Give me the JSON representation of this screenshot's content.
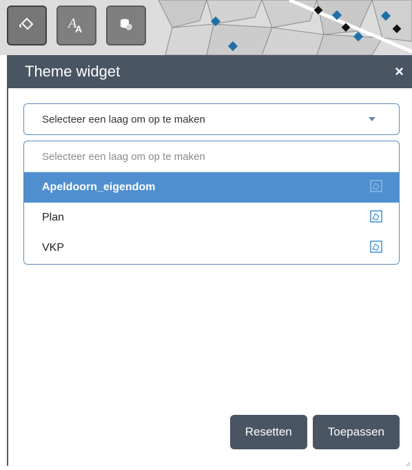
{
  "toolbar": {
    "buttons": [
      {
        "icon": "paint-bucket-icon"
      },
      {
        "icon": "font-style-icon"
      },
      {
        "icon": "database-layers-icon"
      }
    ]
  },
  "widget": {
    "title": "Theme widget",
    "close_label": "×",
    "select": {
      "value": "Selecteer een laag om op te maken"
    },
    "dropdown": {
      "placeholder": "Selecteer een laag om op te maken",
      "items": [
        {
          "label": "Apeldoorn_eigendom",
          "selected": true,
          "icon": "polygon-layer-icon"
        },
        {
          "label": "Plan",
          "selected": false,
          "icon": "polygon-layer-icon"
        },
        {
          "label": "VKP",
          "selected": false,
          "icon": "polygon-layer-icon"
        }
      ]
    },
    "reset_label": "Resetten",
    "apply_label": "Toepassen"
  },
  "colors": {
    "header": "#4a5563",
    "accent": "#4f8fcf",
    "border": "#5b8ab5",
    "map_marker": "#1f6fa8"
  }
}
